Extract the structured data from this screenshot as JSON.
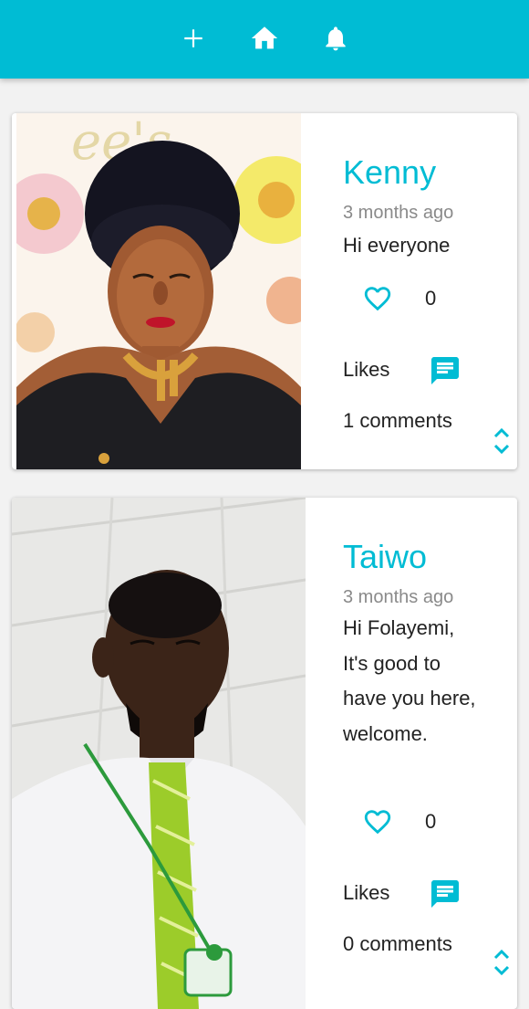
{
  "header": {
    "icons": [
      "add-icon",
      "home-icon",
      "notifications-icon"
    ],
    "accent_color": "#00bcd4"
  },
  "posts": [
    {
      "author": "Kenny",
      "time": "3 months ago",
      "message": "Hi everyone",
      "like_count": "0",
      "likes_label": "Likes",
      "comments_label": "1 comments"
    },
    {
      "author": "Taiwo",
      "time": "3 months ago",
      "message": "Hi Folayemi, It's good to have you here, welcome.",
      "like_count": "0",
      "likes_label": "Likes",
      "comments_label": "0 comments"
    }
  ]
}
